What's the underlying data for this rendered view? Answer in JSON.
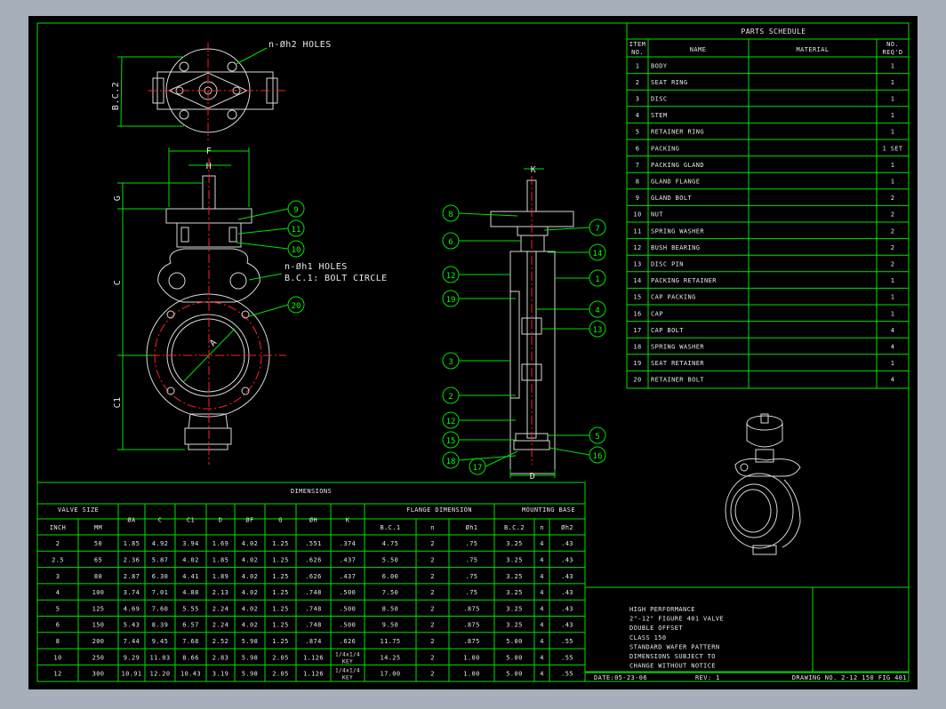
{
  "colors": {
    "background": "#000000",
    "frame": "#00e000",
    "text": "#e8e8e8",
    "centerline": "#ff2020",
    "window": "#a7afbb"
  },
  "top_view": {
    "holes_label": "n-Øh2  HOLES",
    "dim_bc2": "B.C.2"
  },
  "front_view": {
    "dim_f": "F",
    "dim_h": "H",
    "dim_g": "G",
    "dim_c": "C",
    "dim_c1": "C1",
    "dim_a": "A",
    "holes_label": "n-Øh1 HOLES",
    "bolt_circle_label": "B.C.1: BOLT CIRCLE",
    "balloons": [
      "9",
      "11",
      "10",
      "20"
    ]
  },
  "side_view": {
    "dim_k": "K",
    "dim_d": "D",
    "balloons_left": [
      "8",
      "6",
      "12",
      "19",
      "3",
      "2",
      "12",
      "15",
      "18",
      "17"
    ],
    "balloons_right": [
      "7",
      "14",
      "1",
      "4",
      "13",
      "5",
      "16"
    ]
  },
  "parts_schedule": {
    "title": "PARTS SCHEDULE",
    "headers": {
      "item": "ITEM",
      "item_no": "NO.",
      "name": "NAME",
      "material": "MATERIAL",
      "no": "NO.",
      "req": "REQ'D"
    },
    "rows": [
      {
        "item": "1",
        "name": "BODY",
        "material": "",
        "req": "1"
      },
      {
        "item": "2",
        "name": "SEAT RING",
        "material": "",
        "req": "1"
      },
      {
        "item": "3",
        "name": "DISC",
        "material": "",
        "req": "1"
      },
      {
        "item": "4",
        "name": "STEM",
        "material": "",
        "req": "1"
      },
      {
        "item": "5",
        "name": "RETAINER RING",
        "material": "",
        "req": "1"
      },
      {
        "item": "6",
        "name": "PACKING",
        "material": "",
        "req": "1 SET"
      },
      {
        "item": "7",
        "name": "PACKING GLAND",
        "material": "",
        "req": "1"
      },
      {
        "item": "8",
        "name": "GLAND FLANGE",
        "material": "",
        "req": "1"
      },
      {
        "item": "9",
        "name": "GLAND BOLT",
        "material": "",
        "req": "2"
      },
      {
        "item": "10",
        "name": "NUT",
        "material": "",
        "req": "2"
      },
      {
        "item": "11",
        "name": "SPRING WASHER",
        "material": "",
        "req": "2"
      },
      {
        "item": "12",
        "name": "BUSH BEARING",
        "material": "",
        "req": "2"
      },
      {
        "item": "13",
        "name": "DISC PIN",
        "material": "",
        "req": "2"
      },
      {
        "item": "14",
        "name": "PACKING RETAINER",
        "material": "",
        "req": "1"
      },
      {
        "item": "15",
        "name": "CAP PACKING",
        "material": "",
        "req": "1"
      },
      {
        "item": "16",
        "name": "CAP",
        "material": "",
        "req": "1"
      },
      {
        "item": "17",
        "name": "CAP BOLT",
        "material": "",
        "req": "4"
      },
      {
        "item": "18",
        "name": "SPRING WASHER",
        "material": "",
        "req": "4"
      },
      {
        "item": "19",
        "name": "SEAT RETAINER",
        "material": "",
        "req": "1"
      },
      {
        "item": "20",
        "name": "RETAINER BOLT",
        "material": "",
        "req": "4"
      }
    ]
  },
  "dimensions": {
    "title": "DIMENSIONS",
    "group_headers": {
      "valve_size": "VALVE SIZE",
      "flange": "FLANGE DIMENSION",
      "mounting": "MOUNTING BASE"
    },
    "columns": [
      "INCH",
      "MM",
      "ØA",
      "C",
      "C1",
      "D",
      "ØF",
      "G",
      "ØH",
      "K",
      "B.C.1",
      "n",
      "Øh1",
      "B.C.2",
      "n",
      "Øh2"
    ],
    "rows": [
      [
        "2",
        "50",
        "1.85",
        "4.92",
        "3.94",
        "1.69",
        "4.02",
        "1.25",
        ".551",
        ".374",
        "4.75",
        "2",
        ".75",
        "3.25",
        "4",
        ".43"
      ],
      [
        "2.5",
        "65",
        "2.36",
        "5.87",
        "4.02",
        "1.85",
        "4.02",
        "1.25",
        ".626",
        ".437",
        "5.50",
        "2",
        ".75",
        "3.25",
        "4",
        ".43"
      ],
      [
        "3",
        "80",
        "2.87",
        "6.30",
        "4.41",
        "1.89",
        "4.02",
        "1.25",
        ".626",
        ".437",
        "6.00",
        "2",
        ".75",
        "3.25",
        "4",
        ".43"
      ],
      [
        "4",
        "100",
        "3.74",
        "7.01",
        "4.88",
        "2.13",
        "4.02",
        "1.25",
        ".748",
        ".500",
        "7.50",
        "2",
        ".75",
        "3.25",
        "4",
        ".43"
      ],
      [
        "5",
        "125",
        "4.69",
        "7.60",
        "5.55",
        "2.24",
        "4.02",
        "1.25",
        ".748",
        ".500",
        "8.50",
        "2",
        ".875",
        "3.25",
        "4",
        ".43"
      ],
      [
        "6",
        "150",
        "5.43",
        "8.39",
        "6.57",
        "2.24",
        "4.02",
        "1.25",
        ".748",
        ".500",
        "9.50",
        "2",
        ".875",
        "3.25",
        "4",
        ".43"
      ],
      [
        "8",
        "200",
        "7.44",
        "9.45",
        "7.68",
        "2.52",
        "5.98",
        "1.25",
        ".874",
        ".626",
        "11.75",
        "2",
        ".875",
        "5.00",
        "4",
        ".55"
      ],
      [
        "10",
        "250",
        "9.29",
        "11.03",
        "8.66",
        "2.83",
        "5.98",
        "2.05",
        "1.126",
        "1/4x1/4 KEY",
        "14.25",
        "2",
        "1.00",
        "5.00",
        "4",
        ".55"
      ],
      [
        "12",
        "300",
        "10.91",
        "12.20",
        "10.43",
        "3.19",
        "5.98",
        "2.05",
        "1.126",
        "1/4x1/4 KEY",
        "17.00",
        "2",
        "1.00",
        "5.00",
        "4",
        ".55"
      ]
    ]
  },
  "title_block": {
    "lines": [
      "HIGH PERFORMANCE",
      "2\"-12\" FIGURE 401 VALVE",
      "DOUBLE OFFSET",
      "CLASS 150",
      "STANDARD WAFER PATTERN",
      "DIMENSIONS SUBJECT TO",
      "CHANGE WITHOUT NOTICE"
    ],
    "date": "DATE:05-23-06",
    "rev": "REV: 1",
    "drawing_no": "DRAWING NO. 2-12 150 FIG 401"
  }
}
